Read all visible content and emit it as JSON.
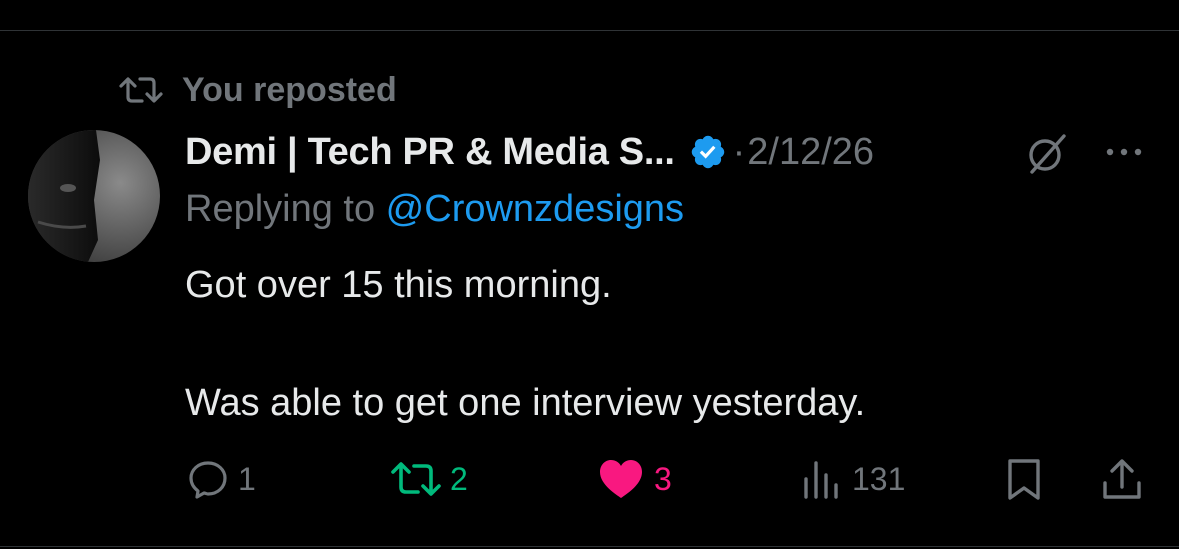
{
  "repost_banner": {
    "text": "You reposted",
    "icon": "repost-icon"
  },
  "author": {
    "display_name": "Demi | Tech PR & Media S...",
    "verified": true
  },
  "meta": {
    "separator": "·",
    "date": "2/12/26"
  },
  "reply_context": {
    "prefix": "Replying to ",
    "mention": "@Crownzdesigns"
  },
  "body": {
    "line1": "Got over 15 this morning.",
    "line2": "Was able to get one interview yesterday."
  },
  "actions": {
    "replies": "1",
    "reposts": "2",
    "likes": "3",
    "views": "131"
  },
  "colors": {
    "background": "#000000",
    "text_primary": "#e7e9ea",
    "text_secondary": "#71767b",
    "link": "#1d9bf0",
    "repost_active": "#00ba7c",
    "like_active": "#f91880",
    "verified": "#1d9bf0"
  }
}
